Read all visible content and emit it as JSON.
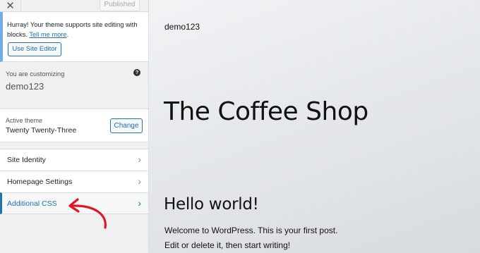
{
  "header": {
    "close_glyph": "✕",
    "publish_label": "Published"
  },
  "notice": {
    "text": "Hurray! Your theme supports site editing with blocks.",
    "link": "Tell me more",
    "link_suffix": ".",
    "button": "Use Site Editor"
  },
  "customizing": {
    "label": "You are customizing",
    "site": "demo123",
    "help_glyph": "?"
  },
  "theme": {
    "label": "Active theme",
    "name": "Twenty Twenty-Three",
    "change_label": "Change"
  },
  "panels": [
    {
      "label": "Site Identity",
      "chevron": "›"
    },
    {
      "label": "Homepage Settings",
      "chevron": "›"
    },
    {
      "label": "Additional CSS",
      "chevron": "›"
    }
  ],
  "preview": {
    "site_name": "demo123",
    "site_title": "The Coffee Shop",
    "post_title": "Hello world!",
    "post_line1": "Welcome to WordPress. This is your first post.",
    "post_line2": "Edit or delete it, then start writing!"
  },
  "colors": {
    "accent": "#2271b1",
    "annotation": "#e2141e"
  },
  "icons": [
    "close-icon",
    "help-icon",
    "chevron-right-icon",
    "red-arrow-annotation"
  ]
}
